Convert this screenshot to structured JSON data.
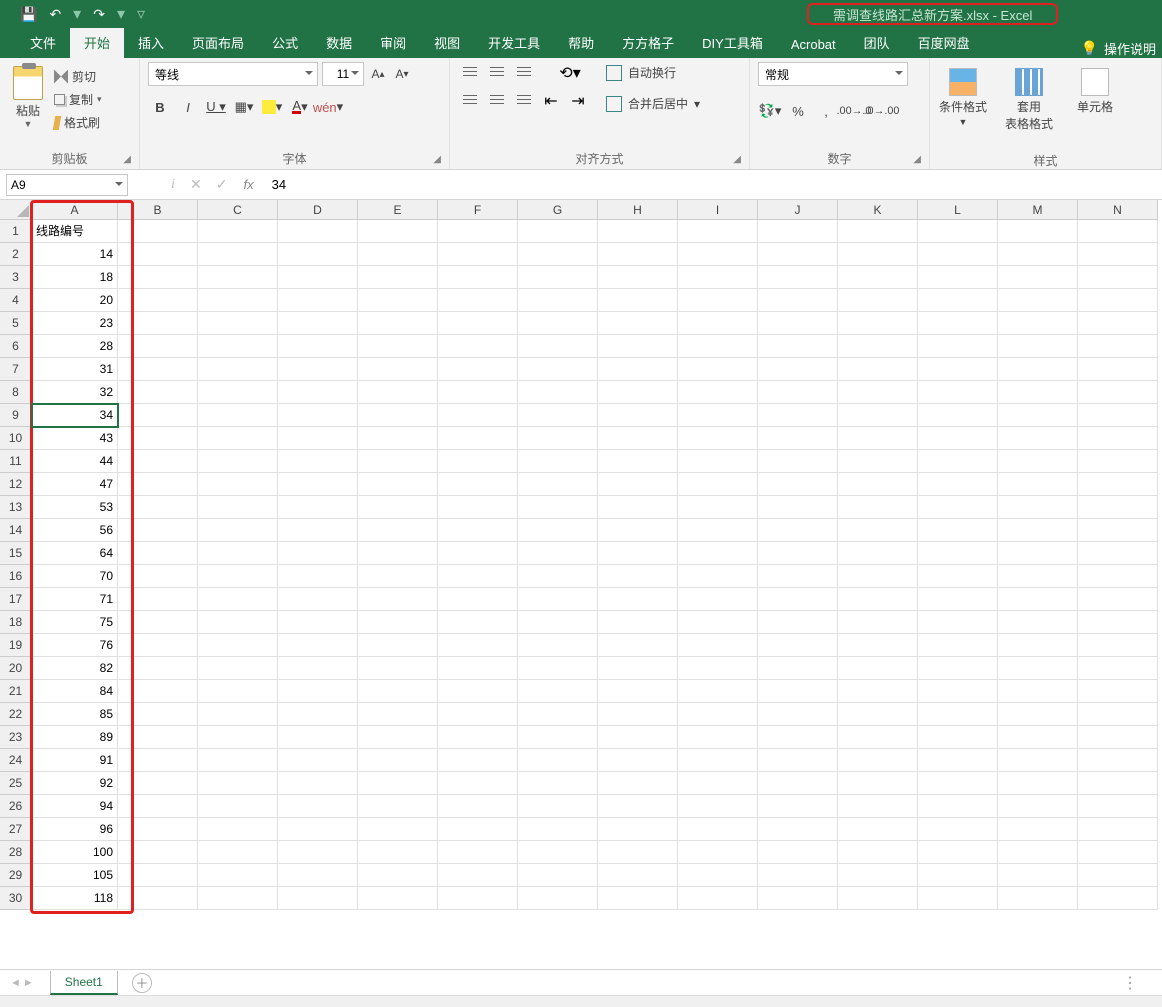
{
  "title": {
    "document": "需调查线路汇总新方案.xlsx",
    "app": "Excel",
    "full": "需调查线路汇总新方案.xlsx  -  Excel"
  },
  "ribbon": {
    "tabs": [
      "文件",
      "开始",
      "插入",
      "页面布局",
      "公式",
      "数据",
      "审阅",
      "视图",
      "开发工具",
      "帮助",
      "方方格子",
      "DIY工具箱",
      "Acrobat",
      "团队",
      "百度网盘"
    ],
    "active_tab": "开始",
    "tell_me": "操作说明"
  },
  "clipboard": {
    "paste": "粘贴",
    "cut": "剪切",
    "copy": "复制",
    "format_painter": "格式刷",
    "group_label": "剪贴板"
  },
  "font": {
    "name": "等线",
    "size": "11",
    "group_label": "字体"
  },
  "alignment": {
    "wrap": "自动换行",
    "merge": "合并后居中",
    "group_label": "对齐方式"
  },
  "number": {
    "format": "常规",
    "group_label": "数字"
  },
  "styles": {
    "conditional": "条件格式",
    "table": "套用\n表格格式",
    "cell": "单元格",
    "group_label": "样式"
  },
  "formula_bar": {
    "name_box": "A9",
    "value": "34"
  },
  "grid": {
    "columns": [
      "A",
      "B",
      "C",
      "D",
      "E",
      "F",
      "G",
      "H",
      "I",
      "J",
      "K",
      "L",
      "M",
      "N"
    ],
    "rows": 30,
    "active_cell": "A9",
    "column_a_header": "线路编号",
    "column_a_values": [
      14,
      18,
      20,
      23,
      28,
      31,
      32,
      34,
      43,
      44,
      47,
      53,
      56,
      64,
      70,
      71,
      75,
      76,
      82,
      84,
      85,
      89,
      91,
      92,
      94,
      96,
      100,
      105,
      118
    ]
  },
  "sheet": {
    "name": "Sheet1"
  }
}
